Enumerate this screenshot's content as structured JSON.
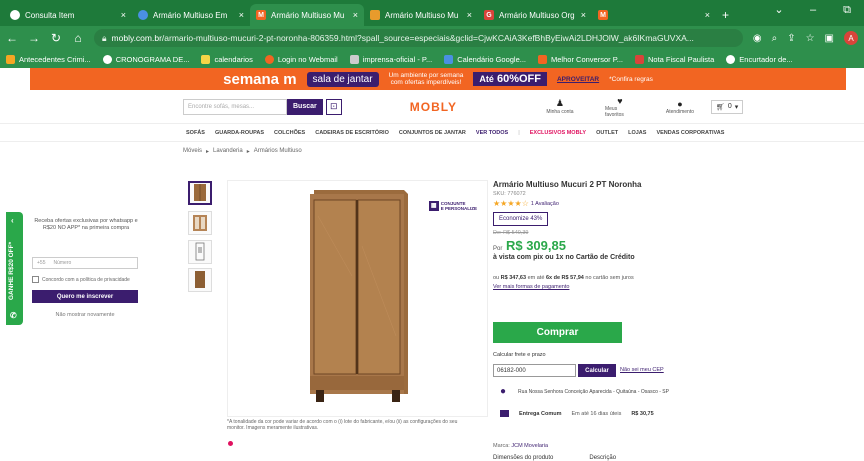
{
  "browser": {
    "tabs": [
      {
        "title": "Consulta Item",
        "fav_color": "#ffffff",
        "fav_text": "",
        "close": "×"
      },
      {
        "title": "Armário Multiuso Em",
        "fav_color": "#4a90e2",
        "fav_text": "",
        "close": "×"
      },
      {
        "title": "Armário Multiuso Mu",
        "fav_color": "#f26522",
        "fav_text": "M",
        "close": "×"
      },
      {
        "title": "Armário Multiuso Mu",
        "fav_color": "#e89b2c",
        "fav_text": "",
        "close": "×"
      },
      {
        "title": "Armário Multiuso Org",
        "fav_color": "#d9443a",
        "fav_text": "G",
        "close": "×"
      },
      {
        "title": "",
        "fav_color": "#f26522",
        "fav_text": "M",
        "close": "×"
      }
    ],
    "new_tab": "+",
    "url_host": "mobly.com.br",
    "url_path": "/armario-multiuso-mucuri-2-pt-noronha-806359.html?spall_source=especiais&gclid=CjwKCAiA3KefBhByEiwAi2LDHJOlW_ak6IKmaGUVXA...",
    "avatar_letter": "A",
    "bookmarks": [
      {
        "label": "Antecedentes Crimi...",
        "color": "#f5a623"
      },
      {
        "label": "CRONOGRAMA DE...",
        "color": "#ffffff"
      },
      {
        "label": "calendarios",
        "color": "#f5d547"
      },
      {
        "label": "Login no Webmail",
        "color": "#f26522"
      },
      {
        "label": "imprensa-oficial - P...",
        "color": "#cccccc"
      },
      {
        "label": "Calendário Google...",
        "color": "#4a90e2"
      },
      {
        "label": "Melhor Conversor P...",
        "color": "#f26522"
      },
      {
        "label": "Nota Fiscal Paulista",
        "color": "#d9443a"
      },
      {
        "label": "Encurtador de...",
        "color": "#ffffff"
      }
    ]
  },
  "promo": {
    "big": "semana m",
    "pill": "sala de jantar",
    "sub_top": "Um ambiente por semana",
    "sub_bottom": "com ofertas imperdíveis!",
    "ate": "Até",
    "pct": "60",
    "off": "%OFF",
    "cta": "APROVEITAR",
    "fine": "*Confira regras"
  },
  "header": {
    "search_placeholder": "Encontre sofás, mesas...",
    "search_button": "Buscar",
    "logo": "MOBLY",
    "account": "Minha conta",
    "favorites": "Meus favoritos",
    "service": "Atendimento",
    "cart_count": "0"
  },
  "categories": [
    "SOFÁS",
    "GUARDA-ROUPAS",
    "COLCHÕES",
    "CADEIRAS DE ESCRITÓRIO",
    "CONJUNTOS DE JANTAR",
    "VER TODOS",
    "EXCLUSIVOS MOBLY",
    "OUTLET",
    "LOJAS",
    "VENDAS CORPORATIVAS"
  ],
  "breadcrumb": [
    "Móveis",
    "Lavanderia",
    "Armários Multiuso"
  ],
  "newsletter": {
    "tab": "GANHE R$20 OFF*",
    "text": "Receba ofertas exclusivas por whatsapp e R$20 NO APP* na primeira compra",
    "country": "+55",
    "phone_placeholder": "Número",
    "consent": "Concordo com a política de privacidade",
    "button": "Quero me inscrever",
    "dismiss": "Não mostrar novamente"
  },
  "product": {
    "title": "Armário Multiuso Mucuri 2 PT Noronha",
    "sku": "SKU: 776072",
    "stars": "★★★★☆",
    "reviews": "1 Avaliação",
    "save": "Economize 43%",
    "old_price": "De: R$ 540,39",
    "price_prefix": "Por",
    "price": "R$ 309,85",
    "pix": "à vista com pix ou 1x no Cartão de Crédito",
    "inst_pre": "ou",
    "inst_total": "R$ 347,63",
    "inst_mid": "em até",
    "inst_count": "6x de R$ 57,94",
    "inst_post": "no cartão sem juros",
    "more_pay": "Ver mais formas de pagamento",
    "buy": "Comprar",
    "shipping_label": "Calcular frete e prazo",
    "cep": "06182-000",
    "calc": "Calcular",
    "no_cep": "Não sei meu CEP",
    "address": "Rua Nossa Senhora Conceição Aparecida - Quitaúna - Osasco - SP",
    "delivery_type": "Entrega Comum",
    "delivery_days": "Em até 16 dias úteis",
    "delivery_price": "R$ 30,75",
    "brand_label": "Marca:",
    "brand": "JCM Movelaria",
    "tab_dims": "Dimensões do produto",
    "tab_desc": "Descrição",
    "badge_line1": "CONJUNTE",
    "badge_line2": "E PERSONALIZE",
    "disclaimer": "*A tonalidade da cor pode variar de acordo com o (i) lote do fabricante, e/ou (ii) as configurações do seu monitor. Imagens meramente ilustrativas."
  }
}
